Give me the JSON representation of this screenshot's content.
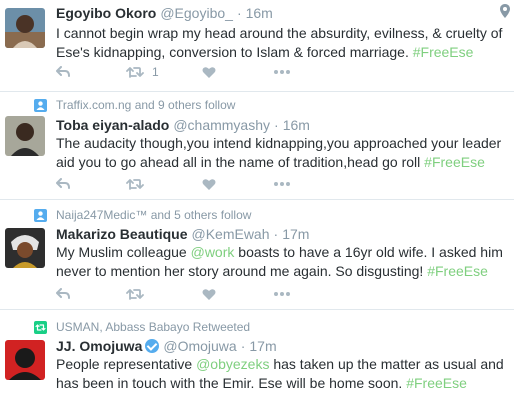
{
  "tweets": [
    {
      "context": "",
      "name": "Egoyibo Okoro",
      "handle": "@Egoyibo_",
      "time": "16m",
      "text_parts": [
        "I cannot begin wrap my head around the absurdity, evilness, & cruelty of Ese's kidnapping, conversion to Islam & forced marriage. ",
        "#FreeEse"
      ],
      "retweet_count": "1",
      "avatar_icon": "avatar-egoyibo"
    },
    {
      "context": "Traffix.com.ng and 9 others follow",
      "context_icon": "person-icon",
      "name": "Toba eiyan-alado",
      "handle": "@chammyashy",
      "time": "16m",
      "text_parts": [
        "The audacity though,you intend kidnapping,you approached your leader aid you to go ahead all in the name of tradition,head go roll ",
        "#FreeEse"
      ],
      "retweet_count": "",
      "avatar_icon": "avatar-toba"
    },
    {
      "context": "Naija247Medic™ and 5 others follow",
      "context_icon": "person-icon",
      "name": "Makarizo Beautique",
      "handle": "@KemEwah",
      "time": "17m",
      "text_parts": [
        "My Muslim colleague ",
        "@work",
        " boasts to have a 16yr old wife. I asked him never to mention her story around me again. So disgusting! ",
        "#FreeEse"
      ],
      "retweet_count": "",
      "avatar_icon": "avatar-makarizo"
    },
    {
      "context": "USMAN, Abbass Babayo Retweeted",
      "context_icon": "retweet-icon",
      "name": "JJ. Omojuwa",
      "handle": "@Omojuwa",
      "time": "17m",
      "text_parts": [
        "People representative ",
        "@obyezeks",
        " has taken up the matter as usual and has been in touch with the Emir. Ese will be home soon. ",
        "#FreeEse"
      ],
      "retweet_count": "",
      "avatar_icon": "avatar-omojuwa"
    }
  ],
  "colors": {
    "accent_green": "#7fcf7f",
    "meta_gray": "#8899a6",
    "text": "#292f33",
    "verified_blue": "#55acee"
  },
  "dot": "·"
}
